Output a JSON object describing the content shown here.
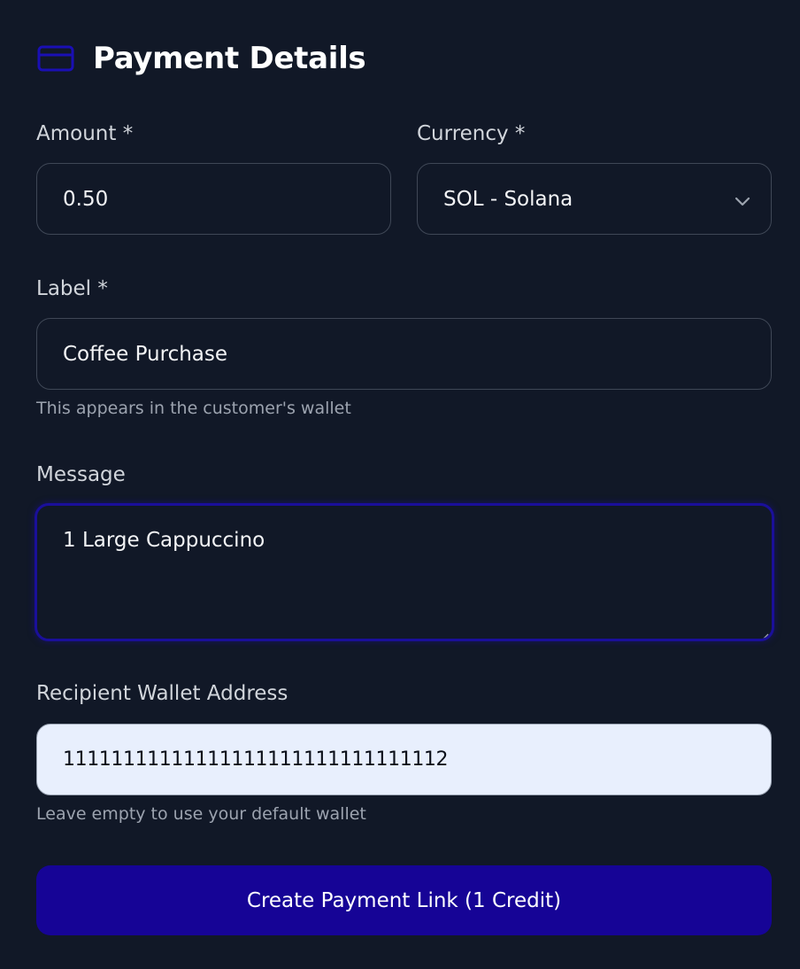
{
  "section": {
    "title": "Payment Details",
    "icon": "credit-card-icon",
    "icon_color": "#1a0fb4"
  },
  "amount": {
    "label": "Amount *",
    "value": "0.50"
  },
  "currency": {
    "label": "Currency *",
    "selected": "SOL - Solana"
  },
  "label_field": {
    "label": "Label *",
    "value": "Coffee Purchase",
    "help": "This appears in the customer's wallet"
  },
  "message": {
    "label": "Message",
    "value": "1 Large Cappuccino"
  },
  "wallet": {
    "label": "Recipient Wallet Address",
    "value": "11111111111111111111111111111112",
    "help": "Leave empty to use your default wallet"
  },
  "submit": {
    "label": "Create Payment Link (1 Credit)",
    "color": "#160496"
  },
  "colors": {
    "background": "#111827",
    "focus_border": "#1a0f9a",
    "wallet_field_bg": "#e8effd"
  }
}
